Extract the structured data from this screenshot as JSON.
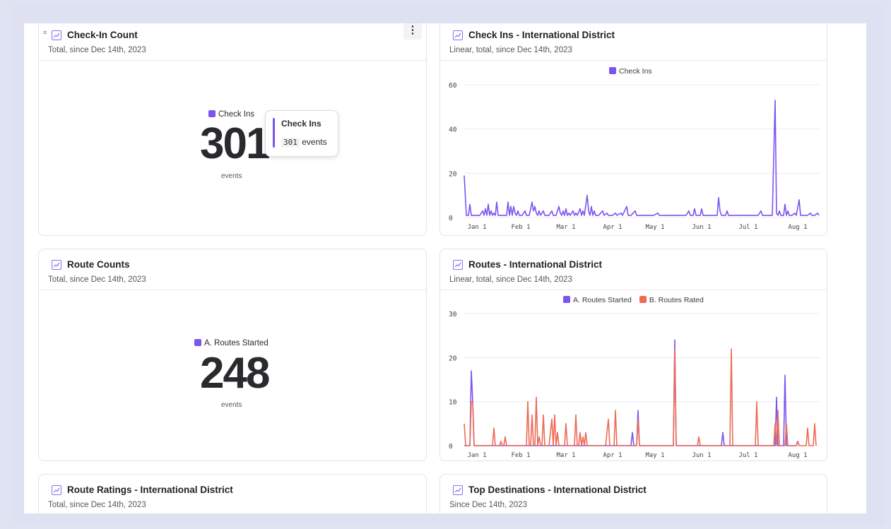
{
  "colors": {
    "purple": "#7b55f0",
    "orange": "#ee6b55",
    "grid": "#ececf1"
  },
  "cards": {
    "checkin_count": {
      "title": "Check-In Count",
      "subtitle": "Total, since Dec 14th, 2023",
      "legend": "Check Ins",
      "value": "301",
      "unit": "events",
      "tooltip": {
        "title": "Check Ins",
        "value": "301",
        "unit": "events"
      }
    },
    "checkins_intl": {
      "title": "Check Ins - International District",
      "subtitle": "Linear, total, since Dec 14th, 2023",
      "legend": "Check Ins"
    },
    "route_counts": {
      "title": "Route Counts",
      "subtitle": "Total, since Dec 14th, 2023",
      "legend": "A. Routes Started",
      "value": "248",
      "unit": "events"
    },
    "routes_intl": {
      "title": "Routes - International District",
      "subtitle": "Linear, total, since Dec 14th, 2023",
      "legend_a": "A. Routes Started",
      "legend_b": "B. Routes Rated"
    },
    "route_ratings": {
      "title": "Route Ratings - International District",
      "subtitle": "Total, since Dec 14th, 2023"
    },
    "top_destinations": {
      "title": "Top Destinations - International District",
      "subtitle": "Since Dec 14th, 2023"
    }
  },
  "chart_data": [
    {
      "type": "line",
      "x_ticks": [
        "Jan 1",
        "Feb 1",
        "Mar 1",
        "Apr 1",
        "May 1",
        "Jun 1",
        "Jul 1",
        "Aug 1"
      ],
      "ylim": [
        0,
        60
      ],
      "y_ticks": [
        0,
        20,
        40,
        60
      ],
      "legend": "top-center",
      "series": [
        {
          "name": "Check Ins",
          "color": "#7b55f0",
          "values": [
            19,
            3,
            0,
            0,
            0,
            5,
            0,
            0,
            0,
            0,
            0,
            0,
            0,
            0,
            0,
            0,
            1,
            0,
            3,
            0,
            4,
            0,
            5,
            0,
            2,
            0,
            1,
            0,
            0,
            0,
            6,
            0,
            1,
            0,
            5,
            0,
            1,
            0,
            2,
            0,
            0,
            0,
            0,
            0,
            0,
            0,
            7,
            0,
            1,
            0,
            5,
            0,
            1,
            0,
            5,
            0,
            1,
            0,
            2,
            0,
            1,
            0,
            0,
            0,
            0,
            0,
            2,
            0,
            3,
            0,
            2,
            0,
            0,
            0,
            0,
            0,
            0,
            0,
            7,
            0,
            1,
            0,
            5,
            0,
            3,
            0,
            2,
            0,
            0,
            0,
            0,
            0,
            0,
            0,
            0,
            0,
            2,
            0,
            0,
            0,
            0,
            0,
            0,
            0,
            0,
            0,
            3,
            0,
            0,
            0,
            0,
            0,
            0,
            0,
            0,
            0,
            0,
            0,
            3,
            0,
            0,
            0,
            0,
            0,
            0,
            0,
            0,
            0,
            0,
            0,
            0,
            0,
            2,
            0,
            0,
            0,
            0,
            0,
            0,
            0,
            0,
            0,
            0,
            0,
            0,
            0,
            0,
            0,
            0,
            0,
            0,
            0,
            0,
            0,
            0,
            0,
            0,
            0,
            0,
            0,
            0,
            0,
            0,
            0,
            0,
            0,
            0,
            0,
            0,
            0,
            0,
            0,
            0,
            0,
            0,
            0,
            0,
            0,
            0,
            0,
            0,
            0,
            0,
            0,
            0,
            0,
            0,
            0,
            0,
            0,
            0,
            0,
            0,
            0,
            0,
            0,
            0,
            0,
            0,
            0,
            0,
            0,
            0,
            0,
            0,
            0,
            0,
            0,
            0,
            0,
            0,
            0,
            0,
            0,
            0,
            0,
            0,
            0,
            0,
            0,
            0,
            0,
            0,
            0,
            0,
            0,
            0,
            0,
            0,
            0,
            0,
            0,
            0,
            0,
            0,
            0,
            0,
            0,
            0,
            0,
            0,
            0,
            0,
            0,
            0,
            0,
            0,
            0,
            0,
            0,
            0,
            0,
            0,
            0,
            0,
            0,
            0,
            0,
            0,
            0,
            0,
            0,
            0,
            0,
            0,
            0,
            0,
            0
          ]
        }
      ]
    },
    {
      "type": "line",
      "x_ticks": [
        "Jan 1",
        "Feb 1",
        "Mar 1",
        "Apr 1",
        "May 1",
        "Jun 1",
        "Jul 1",
        "Aug 1"
      ],
      "ylim": [
        0,
        30
      ],
      "y_ticks": [
        0,
        10,
        20,
        30
      ],
      "legend": "top-center",
      "series": [
        {
          "name": "A. Routes Started",
          "color": "#7b55f0"
        },
        {
          "name": "B. Routes Rated",
          "color": "#ee6b55"
        }
      ]
    }
  ]
}
